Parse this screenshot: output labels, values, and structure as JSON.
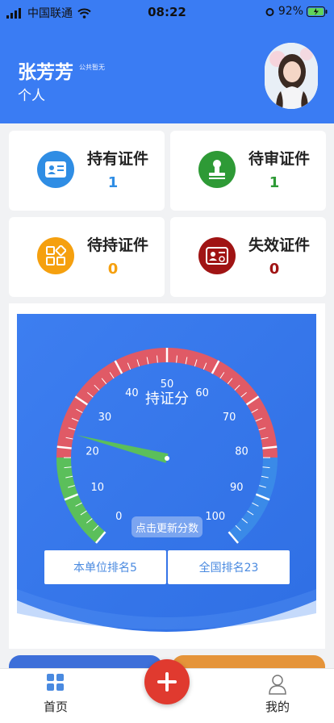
{
  "status_bar": {
    "carrier": "中国联通",
    "time": "08:22",
    "battery": "92%"
  },
  "user": {
    "name": "张芳芳",
    "note": "公共暂无",
    "type": "个人"
  },
  "cards": [
    {
      "title": "持有证件",
      "count": "1",
      "color": "#2f8de4",
      "icon": "id-card-icon"
    },
    {
      "title": "待审证件",
      "count": "1",
      "color": "#2e9a36",
      "icon": "stamp-icon"
    },
    {
      "title": "待持证件",
      "count": "0",
      "color": "#f5a00f",
      "icon": "grid-apps-icon"
    },
    {
      "title": "失效证件",
      "count": "0",
      "color": "#a01414",
      "icon": "expired-card-icon"
    }
  ],
  "gauge": {
    "title": "持证分",
    "ticks": [
      "0",
      "10",
      "20",
      "30",
      "40",
      "50",
      "60",
      "70",
      "80",
      "90",
      "100"
    ],
    "value": 23,
    "refresh_hint": "点击更新分数"
  },
  "ranks": {
    "unit": "本单位排名5",
    "national": "全国排名23"
  },
  "tabs": {
    "home": "首页",
    "mine": "我的"
  },
  "colors": {
    "header": "#3a7cf3",
    "gauge_red": "#e05a66",
    "gauge_green": "#5bbf5b",
    "gauge_blue": "#3a8ae8",
    "fab": "#e03a2f"
  }
}
